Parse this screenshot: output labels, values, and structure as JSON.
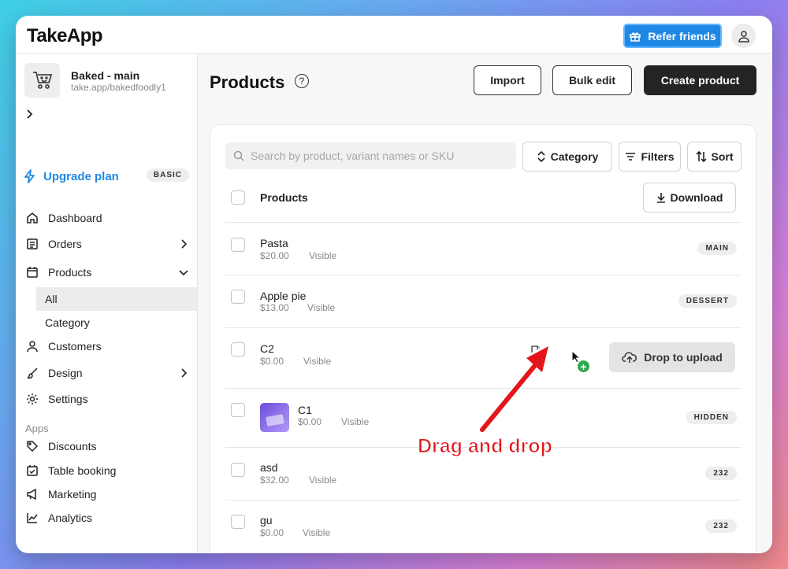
{
  "app": {
    "logo": "TakeApp"
  },
  "topbar": {
    "refer_label": "Refer friends"
  },
  "store": {
    "name": "Baked - main",
    "url": "take.app/bakedfoodly1"
  },
  "sidebar": {
    "upgrade_label": "Upgrade plan",
    "plan_badge": "BASIC",
    "items": [
      {
        "label": "Dashboard"
      },
      {
        "label": "Orders"
      },
      {
        "label": "Products"
      },
      {
        "label": "All"
      },
      {
        "label": "Category"
      },
      {
        "label": "Customers"
      },
      {
        "label": "Design"
      },
      {
        "label": "Settings"
      }
    ],
    "apps_heading": "Apps",
    "apps": [
      {
        "label": "Discounts"
      },
      {
        "label": "Table booking"
      },
      {
        "label": "Marketing"
      },
      {
        "label": "Analytics"
      }
    ]
  },
  "main": {
    "title": "Products",
    "help": "?",
    "import_label": "Import",
    "bulk_edit_label": "Bulk edit",
    "create_label": "Create product",
    "search_placeholder": "Search by product, variant names or SKU",
    "category_label": "Category",
    "filters_label": "Filters",
    "sort_label": "Sort",
    "table_header": "Products",
    "download_label": "Download",
    "drop_label": "Drop to upload",
    "rows": [
      {
        "name": "Pasta",
        "price": "$20.00",
        "visibility": "Visible",
        "tag": "MAIN"
      },
      {
        "name": "Apple pie",
        "price": "$13.00",
        "visibility": "Visible",
        "tag": "DESSERT"
      },
      {
        "name": "C2",
        "price": "$0.00",
        "visibility": "Visible",
        "tag": ""
      },
      {
        "name": "C1",
        "price": "$0.00",
        "visibility": "Visible",
        "tag": "HIDDEN"
      },
      {
        "name": "asd",
        "price": "$32.00",
        "visibility": "Visible",
        "tag": "232"
      },
      {
        "name": "gu",
        "price": "$0.00",
        "visibility": "Visible",
        "tag": "232"
      }
    ]
  },
  "annotation": {
    "text": "Drag and drop",
    "color": "#e4161b"
  },
  "colors": {
    "accent": "#1e88e5",
    "dark_button": "#222426",
    "success": "#2fa84f"
  }
}
